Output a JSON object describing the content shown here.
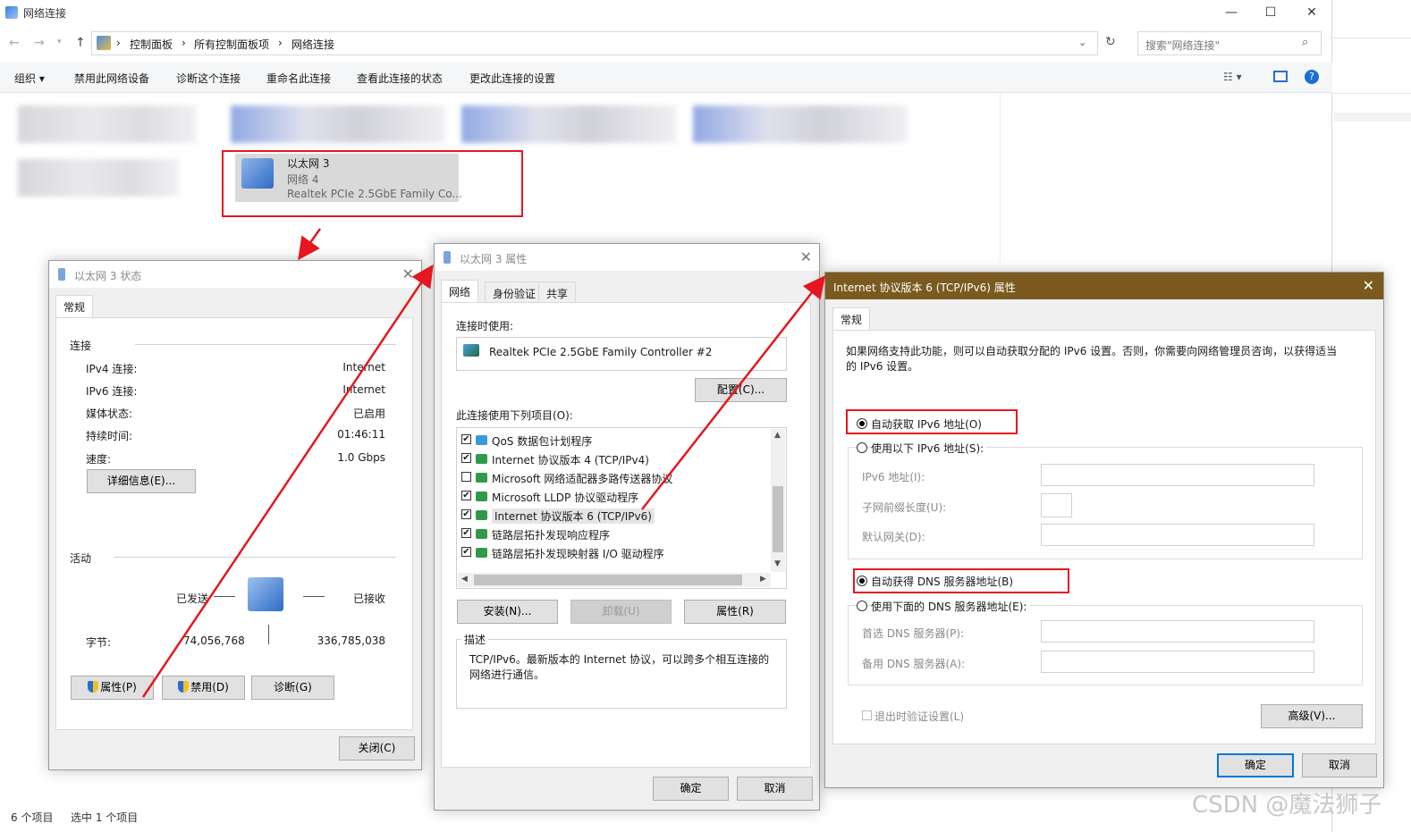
{
  "explorer": {
    "title": "网络连接",
    "breadcrumb": [
      "控制面板",
      "所有控制面板项",
      "网络连接"
    ],
    "search_placeholder": "搜索\"网络连接\"",
    "ribbon": [
      "组织 ▾",
      "禁用此网络设备",
      "诊断这个连接",
      "重命名此连接",
      "查看此连接的状态",
      "更改此连接的设置"
    ],
    "selected_item": {
      "name": "以太网 3",
      "network": "网络 4",
      "adapter": "Realtek PCIe 2.5GbE Family Co..."
    },
    "status": {
      "count": "6 个项目",
      "selected": "选中 1 个项目"
    }
  },
  "status_dialog": {
    "title": "以太网 3 状态",
    "tab": "常规",
    "connection_header": "连接",
    "rows": [
      {
        "label": "IPv4 连接:",
        "value": "Internet"
      },
      {
        "label": "IPv6 连接:",
        "value": "Internet"
      },
      {
        "label": "媒体状态:",
        "value": "已启用"
      },
      {
        "label": "持续时间:",
        "value": "01:46:11"
      },
      {
        "label": "速度:",
        "value": "1.0 Gbps"
      }
    ],
    "details_button": "详细信息(E)...",
    "activity_header": "活动",
    "sent_label": "已发送",
    "received_label": "已接收",
    "bytes_label": "字节:",
    "bytes_sent": "74,056,768",
    "bytes_received": "336,785,038",
    "properties_button": "属性(P)",
    "disable_button": "禁用(D)",
    "diagnose_button": "诊断(G)",
    "close_button": "关闭(C)"
  },
  "props_dialog": {
    "title": "以太网 3 属性",
    "tabs": [
      "网络",
      "身份验证",
      "共享"
    ],
    "connect_using_label": "连接时使用:",
    "adapter": "Realtek PCIe 2.5GbE Family Controller #2",
    "configure_button": "配置(C)...",
    "items_label": "此连接使用下列项目(O):",
    "items": [
      {
        "checked": "✔",
        "label": "QoS 数据包计划程序"
      },
      {
        "checked": "✔",
        "label": "Internet 协议版本 4 (TCP/IPv4)"
      },
      {
        "checked": "",
        "label": "Microsoft 网络适配器多路传送器协议"
      },
      {
        "checked": "✔",
        "label": "Microsoft LLDP 协议驱动程序"
      },
      {
        "checked": "✔",
        "label": "Internet 协议版本 6 (TCP/IPv6)"
      },
      {
        "checked": "✔",
        "label": "链路层拓扑发现响应程序"
      },
      {
        "checked": "✔",
        "label": "链路层拓扑发现映射器 I/O 驱动程序"
      }
    ],
    "install_button": "安装(N)...",
    "uninstall_button": "卸载(U)",
    "properties_button": "属性(R)",
    "description_header": "描述",
    "description": "TCP/IPv6。最新版本的 Internet 协议，可以跨多个相互连接的网络进行通信。",
    "ok_button": "确定",
    "cancel_button": "取消"
  },
  "ipv6_dialog": {
    "title": "Internet 协议版本 6 (TCP/IPv6) 属性",
    "tab": "常规",
    "intro": "如果网络支持此功能，则可以自动获取分配的 IPv6 设置。否则，你需要向网络管理员咨询，以获得适当的 IPv6 设置。",
    "auto_ip": "自动获取 IPv6 地址(O)",
    "manual_ip": "使用以下 IPv6 地址(S):",
    "ipv6_address": "IPv6 地址(I):",
    "prefix_length": "子网前缀长度(U):",
    "gateway": "默认网关(D):",
    "auto_dns": "自动获得 DNS 服务器地址(B)",
    "manual_dns": "使用下面的 DNS 服务器地址(E):",
    "preferred_dns": "首选 DNS 服务器(P):",
    "alternate_dns": "备用 DNS 服务器(A):",
    "validate_on_exit": "退出时验证设置(L)",
    "advanced_button": "高级(V)...",
    "ok_button": "确定",
    "cancel_button": "取消",
    "title_bar_color": "#7a5a1e"
  },
  "watermark": "CSDN @魔法狮子"
}
